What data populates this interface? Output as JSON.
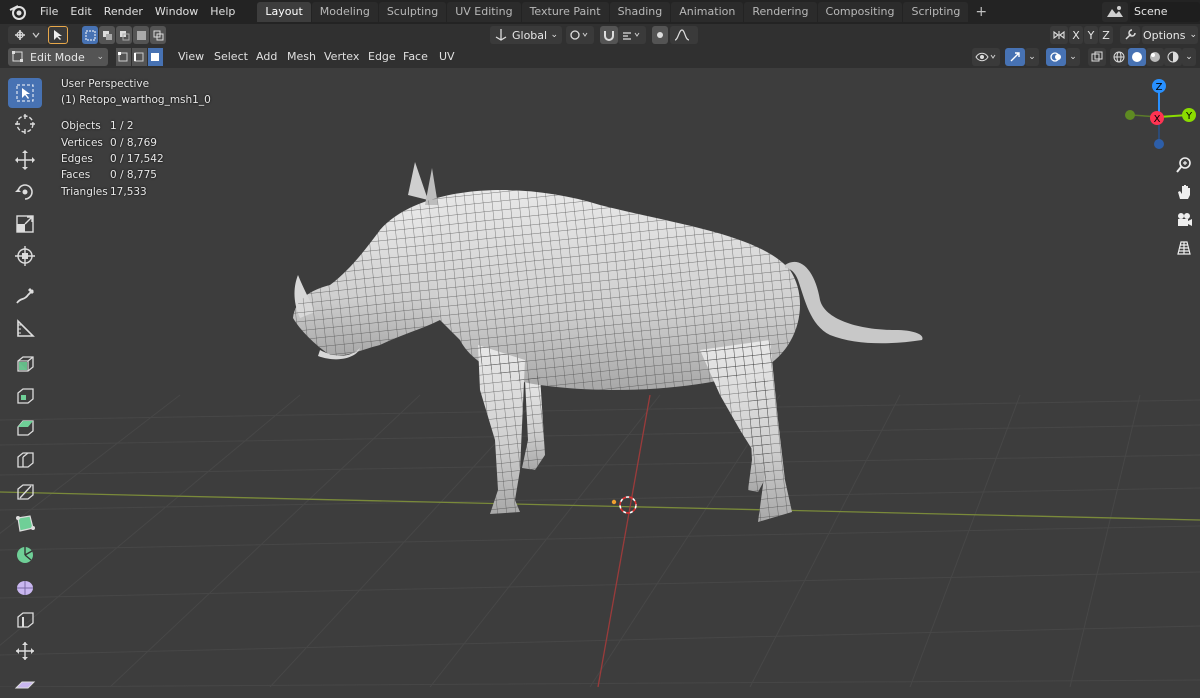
{
  "topbar": {
    "menus": [
      "File",
      "Edit",
      "Render",
      "Window",
      "Help"
    ],
    "workspaces": [
      "Layout",
      "Modeling",
      "Sculpting",
      "UV Editing",
      "Texture Paint",
      "Shading",
      "Animation",
      "Rendering",
      "Compositing",
      "Scripting"
    ],
    "active_workspace": "Layout",
    "add_symbol": "+",
    "scene_name": "Scene"
  },
  "header1": {
    "orientation": "Global",
    "axis_x": "X",
    "axis_y": "Y",
    "axis_z": "Z",
    "options_label": "Options"
  },
  "header2": {
    "mode": "Edit Mode",
    "menus": [
      "View",
      "Select",
      "Add",
      "Mesh",
      "Vertex",
      "Edge",
      "Face",
      "UV"
    ]
  },
  "overlay": {
    "view_name": "User Perspective",
    "object_name": "(1) Retopo_warthog_msh1_0",
    "stats": [
      {
        "label": "Objects",
        "value": "1 / 2"
      },
      {
        "label": "Vertices",
        "value": "0 / 8,769"
      },
      {
        "label": "Edges",
        "value": "0 / 17,542"
      },
      {
        "label": "Faces",
        "value": "0 / 8,775"
      },
      {
        "label": "Triangles",
        "value": "17,533"
      }
    ]
  },
  "gizmo": {
    "z_label": "Z",
    "y_label": "Y",
    "x_label": "X"
  },
  "colors": {
    "accent": "#4772b3",
    "x_axis": "#ff3352",
    "y_axis": "#8bdc00",
    "z_axis": "#2890ff",
    "viewport_bg": "#3d3d3d"
  },
  "icons": {
    "toolbar": [
      "select-box-icon",
      "cursor-icon",
      "move-icon",
      "rotate-icon",
      "scale-icon",
      "transform-icon",
      "annotate-icon",
      "measure-icon",
      "extrude-region-icon",
      "inset-faces-icon",
      "bevel-icon",
      "loop-cut-icon",
      "knife-icon",
      "poly-build-icon",
      "spin-icon",
      "smooth-icon",
      "edge-slide-icon",
      "shrink-fatten-icon",
      "shear-icon"
    ],
    "navigation": [
      "zoom-icon",
      "pan-hand-icon",
      "camera-icon",
      "grid-ortho-icon"
    ]
  }
}
